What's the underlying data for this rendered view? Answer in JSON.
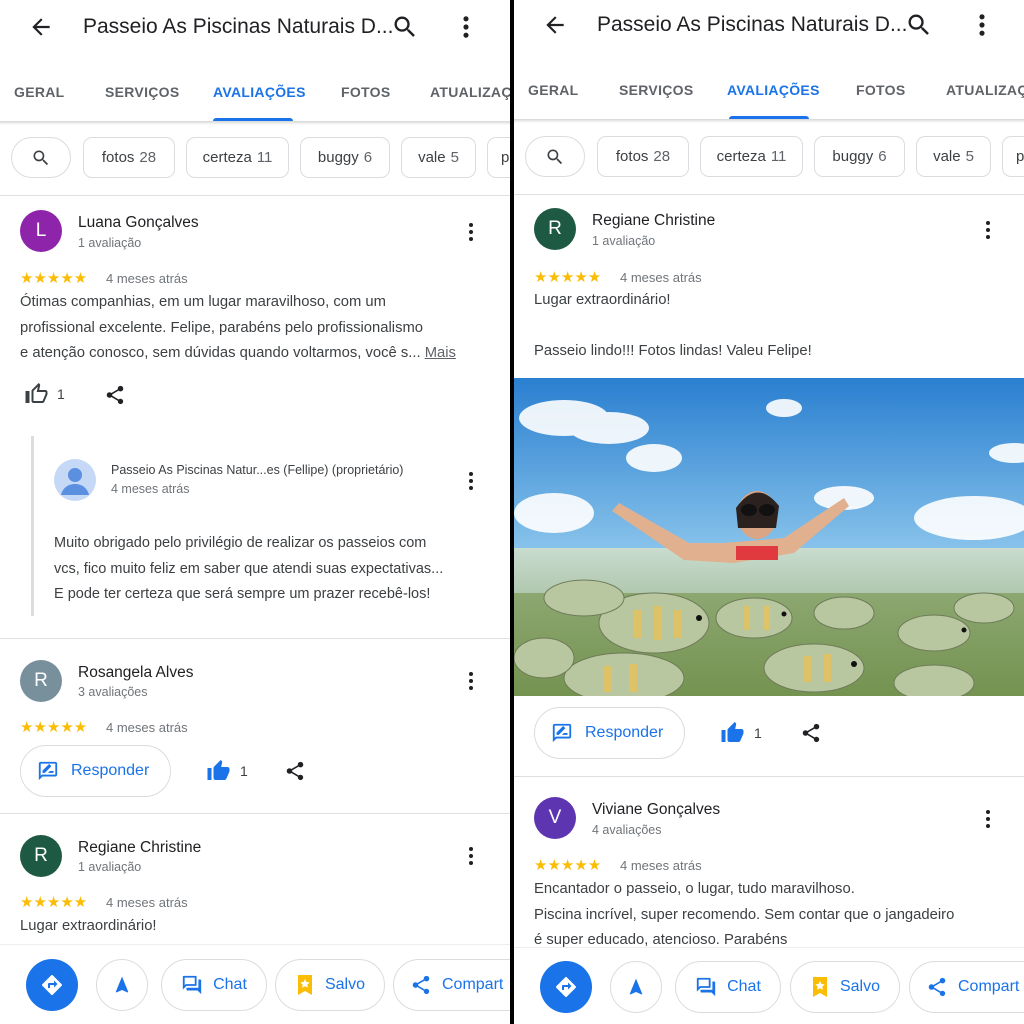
{
  "colors": {
    "accent": "#1a73e8",
    "star": "#fbbc04",
    "avatar_l": "#8e24aa",
    "avatar_r_gray": "#78909c",
    "avatar_r_green": "#1e5a43",
    "avatar_v": "#5e35b1"
  },
  "header": {
    "title": "Passeio As Piscinas Naturais D..."
  },
  "tabs": [
    "GERAL",
    "SERVIÇOS",
    "AVALIAÇÕES",
    "FOTOS",
    "ATUALIZAÇ"
  ],
  "tabs_right": [
    "GERAL",
    "SERVIÇOS",
    "AVALIAÇÕES",
    "FOTOS",
    "ATUALIZAÇ"
  ],
  "chips": [
    {
      "label": "fotos",
      "count": "28"
    },
    {
      "label": "certeza",
      "count": "11"
    },
    {
      "label": "buggy",
      "count": "6"
    },
    {
      "label": "vale",
      "count": "5"
    },
    {
      "label": "p",
      "count": ""
    }
  ],
  "left": {
    "review1": {
      "initial": "L",
      "name": "Luana Gonçalves",
      "sub": "1 avaliação",
      "stars": "★★★★★",
      "ago": "4 meses atrás",
      "text": "Ótimas companhias, em um lugar maravilhoso, com um\nprofissional excelente. Felipe, parabéns pelo profissionalismo\ne atenção conosco, sem dúvidas quando voltarmos, você s... ",
      "more": "Mais",
      "likes": "1",
      "owner_name": "Passeio As Piscinas Natur...es (Fellipe) (proprietário)",
      "owner_ago": "4 meses atrás",
      "owner_text": "Muito obrigado pelo privilégio de realizar os passeios com\nvcs, fico muito feliz em saber que atendi suas expectativas...\nE pode ter certeza que será sempre um prazer recebê-los!"
    },
    "review2": {
      "initial": "R",
      "name": "Rosangela Alves",
      "sub": "3 avaliações",
      "stars": "★★★★★",
      "ago": "4 meses atrás",
      "reply": "Responder",
      "likes": "1"
    },
    "review3": {
      "initial": "R",
      "name": "Regiane Christine",
      "sub": "1 avaliação",
      "stars": "★★★★★",
      "ago": "4 meses atrás",
      "text": "Lugar extraordinário!"
    }
  },
  "right": {
    "review1": {
      "initial": "R",
      "name": "Regiane Christine",
      "sub": "1 avaliação",
      "stars": "★★★★★",
      "ago": "4 meses atrás",
      "text": "Lugar extraordinário!\n\nPasseio lindo!!!  Fotos lindas!  Valeu Felipe!",
      "reply": "Responder",
      "likes": "1"
    },
    "review2": {
      "initial": "V",
      "name": "Viviane Gonçalves",
      "sub": "4 avaliações",
      "stars": "★★★★★",
      "ago": "4 meses atrás",
      "text": "Encantador o passeio, o lugar, tudo maravilhoso.\nPiscina incrível,  super recomendo. Sem contar que o jangadeiro\né super educado, atencioso. Parabéns"
    }
  },
  "bottom": {
    "chat": "Chat",
    "saved": "Salvo",
    "share": "Compart"
  }
}
